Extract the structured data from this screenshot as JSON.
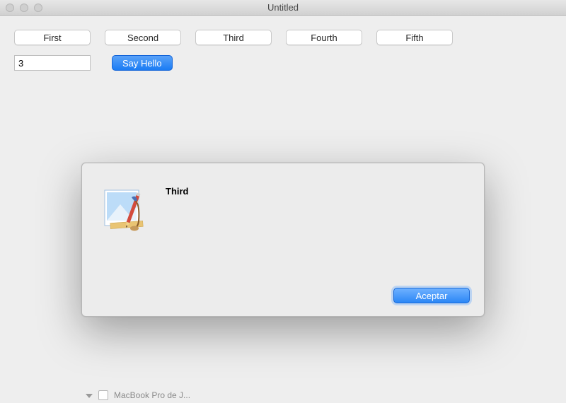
{
  "window": {
    "title": "Untitled"
  },
  "toolbar": {
    "buttons": [
      "First",
      "Second",
      "Third",
      "Fourth",
      "Fifth"
    ]
  },
  "input": {
    "value": "3"
  },
  "actions": {
    "say_hello": "Say Hello"
  },
  "alert": {
    "message": "Third",
    "accept_label": "Aceptar"
  },
  "background": {
    "partial_text": "MacBook Pro de J..."
  }
}
